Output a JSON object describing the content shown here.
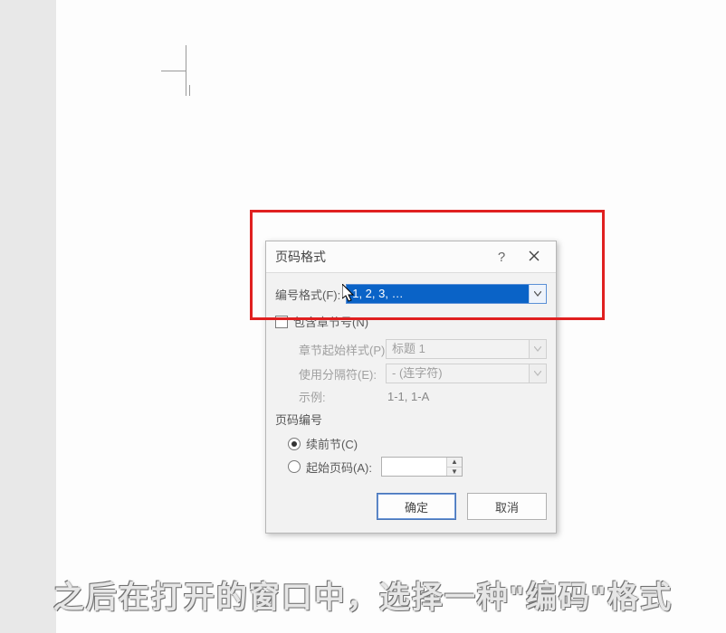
{
  "dialog": {
    "title": "页码格式",
    "format_label": "编号格式(F):",
    "format_value": "1, 2, 3, …",
    "include_chapter_label": "包含章节号(N)",
    "include_chapter_checked": false,
    "chapter_style_label": "章节起始样式(P)",
    "chapter_style_value": "标题 1",
    "separator_label": "使用分隔符(E):",
    "separator_value": "-  (连字符)",
    "example_label": "示例:",
    "example_value": "1-1, 1-A",
    "numbering_section": "页码编号",
    "continue_label": "续前节(C)",
    "start_at_label": "起始页码(A):",
    "start_at_value": "",
    "ok_label": "确定",
    "cancel_label": "取消"
  },
  "subtitle": "之后在打开的窗口中，选择一种\"编码\"格式"
}
